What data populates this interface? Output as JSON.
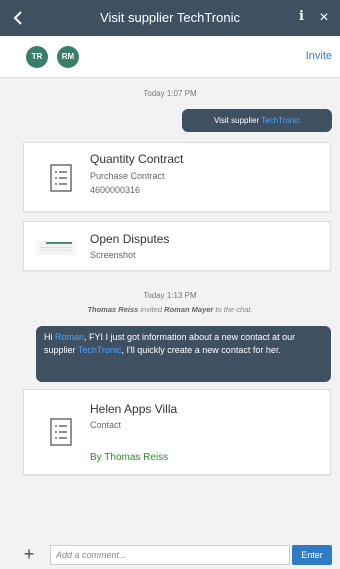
{
  "header": {
    "title": "Visit supplier TechTronic",
    "back_glyph": "<",
    "info_glyph": "i",
    "close_glyph": "×"
  },
  "participants": {
    "avatars": [
      "TR",
      "RM"
    ],
    "invite_label": "Invite"
  },
  "messages": {
    "time1": "Today 1:07 PM",
    "bubble1_prefix": "Visit supplier ",
    "bubble1_highlight": "TechTronic",
    "time2": "Today 1:13 PM",
    "sys_actor": "Thomas Reiss",
    "sys_verb": " invited ",
    "sys_target": "Roman Mayer",
    "sys_tail": " to the chat.",
    "bubble2_hi": "Hi ",
    "bubble2_name": "Roman",
    "bubble2_mid": ", FYI I just got information about a new contact at our supplier ",
    "bubble2_supplier": "TechTronic",
    "bubble2_tail": ", I'll quickly create a new contact for her."
  },
  "cards": {
    "contract": {
      "title": "Quantity Contract",
      "subtitle": "Purchase Contract",
      "number": "4600000316"
    },
    "disputes": {
      "title": "Open Disputes",
      "subtitle": "Screenshot"
    },
    "contact": {
      "title": "Helen Apps Villa",
      "subtitle": "Contact",
      "by": "By Thomas Reiss"
    }
  },
  "composer": {
    "plus_glyph": "+",
    "placeholder": "Add a comment...",
    "enter_label": "Enter"
  },
  "colors": {
    "header_bg": "#3f5161",
    "avatar_bg": "#3a7d6b",
    "highlight": "#4aa3ff",
    "link": "#2f7cc4",
    "by_green": "#2e8b2e"
  }
}
